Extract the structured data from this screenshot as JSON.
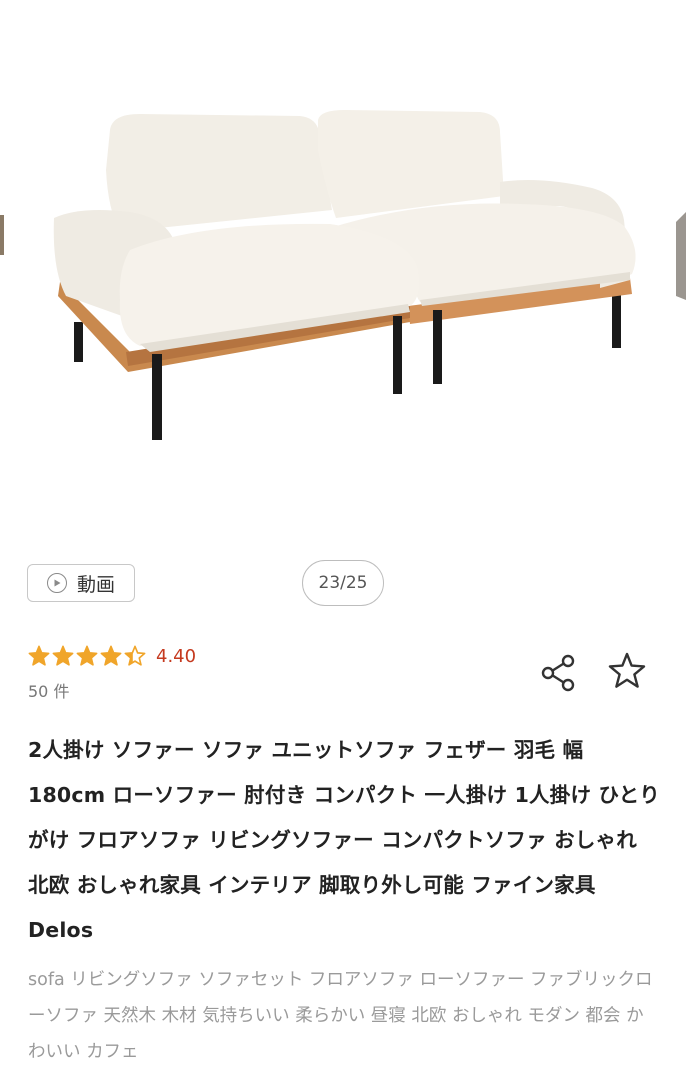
{
  "gallery": {
    "counter": "23/25"
  },
  "video_button": {
    "label": "動画"
  },
  "rating": {
    "stars": 4.4,
    "value": "4.40",
    "review_count": "50 件",
    "star_color": "#f0a52a",
    "value_color": "#c53a1f"
  },
  "product": {
    "title": "2人掛け ソファー ソファ ユニットソファ フェザー 羽毛 幅180cm ローソファー 肘付き コンパクト 一人掛け 1人掛け ひとりがけ フロアソファ リビングソファー コンパクトソファ おしゃれ 北欧 おしゃれ家具 インテリア 脚取り外し可能 ファイン家具 Delos",
    "tags": "sofa リビングソファ ソファセット フロアソファ ローソファー ファブリックローソファ 天然木 木材 気持ちいい 柔らかい 昼寝 北欧 おしゃれ モダン 都会 かわいい カフェ"
  },
  "icons": {
    "share": "share-icon",
    "favorite": "star-outline-icon",
    "video": "play-circle-icon"
  }
}
